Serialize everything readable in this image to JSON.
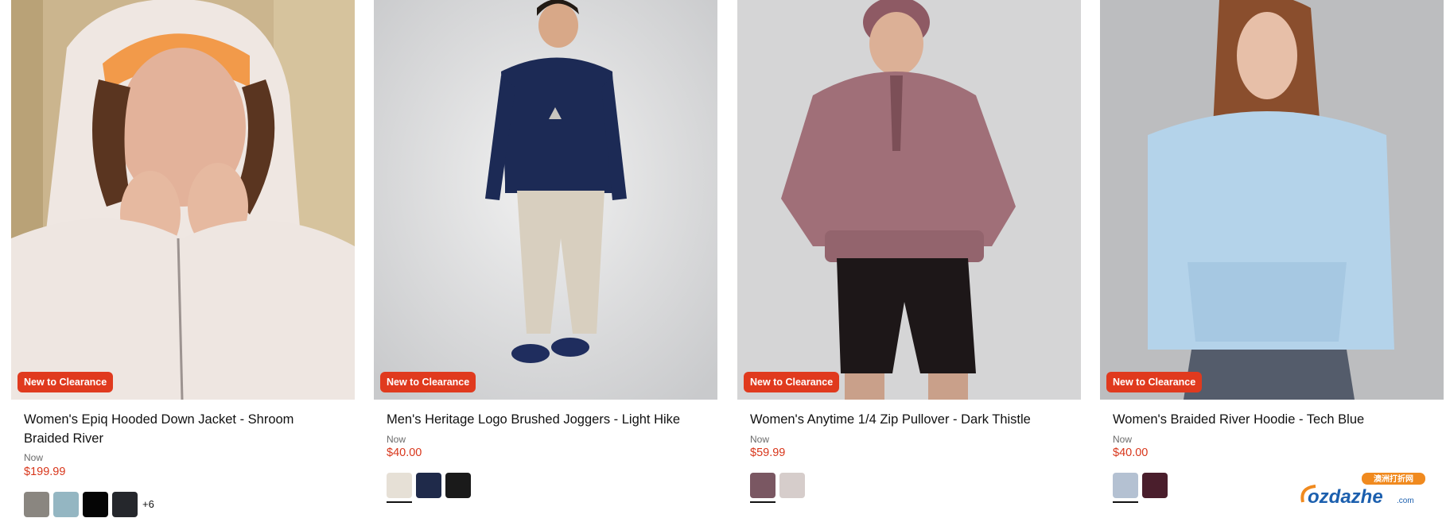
{
  "products": [
    {
      "title": "Women's Epiq Hooded Down Jacket - Shroom Braided River",
      "badge": "New to Clearance",
      "price_label": "Now",
      "price": "$199.99",
      "swatches": [
        "#8a8680",
        "#94b6c2",
        "#050505",
        "#25272c"
      ],
      "more_colors": "+6"
    },
    {
      "title": "Men's Heritage Logo Brushed Joggers - Light Hike",
      "badge": "New to Clearance",
      "price_label": "Now",
      "price": "$40.00",
      "swatches": [
        "#e6e0d6",
        "#1f2a4a",
        "#1a1a1a"
      ],
      "more_colors": ""
    },
    {
      "title": "Women's Anytime 1/4 Zip Pullover - Dark Thistle",
      "badge": "New to Clearance",
      "price_label": "Now",
      "price": "$59.99",
      "swatches": [
        "#7a5762",
        "#d6cdcb"
      ],
      "more_colors": ""
    },
    {
      "title": "Women's Braided River Hoodie - Tech Blue",
      "badge": "New to Clearance",
      "price_label": "Now",
      "price": "$40.00",
      "swatches": [
        "#b4c1d2",
        "#4a1e2c"
      ],
      "more_colors": ""
    }
  ],
  "watermark": {
    "brand": "ozdazhe",
    "suffix": ".com",
    "chinese": "澳洲打折网"
  },
  "colors": {
    "badge": "#e03a1e",
    "price": "#d8361b"
  }
}
